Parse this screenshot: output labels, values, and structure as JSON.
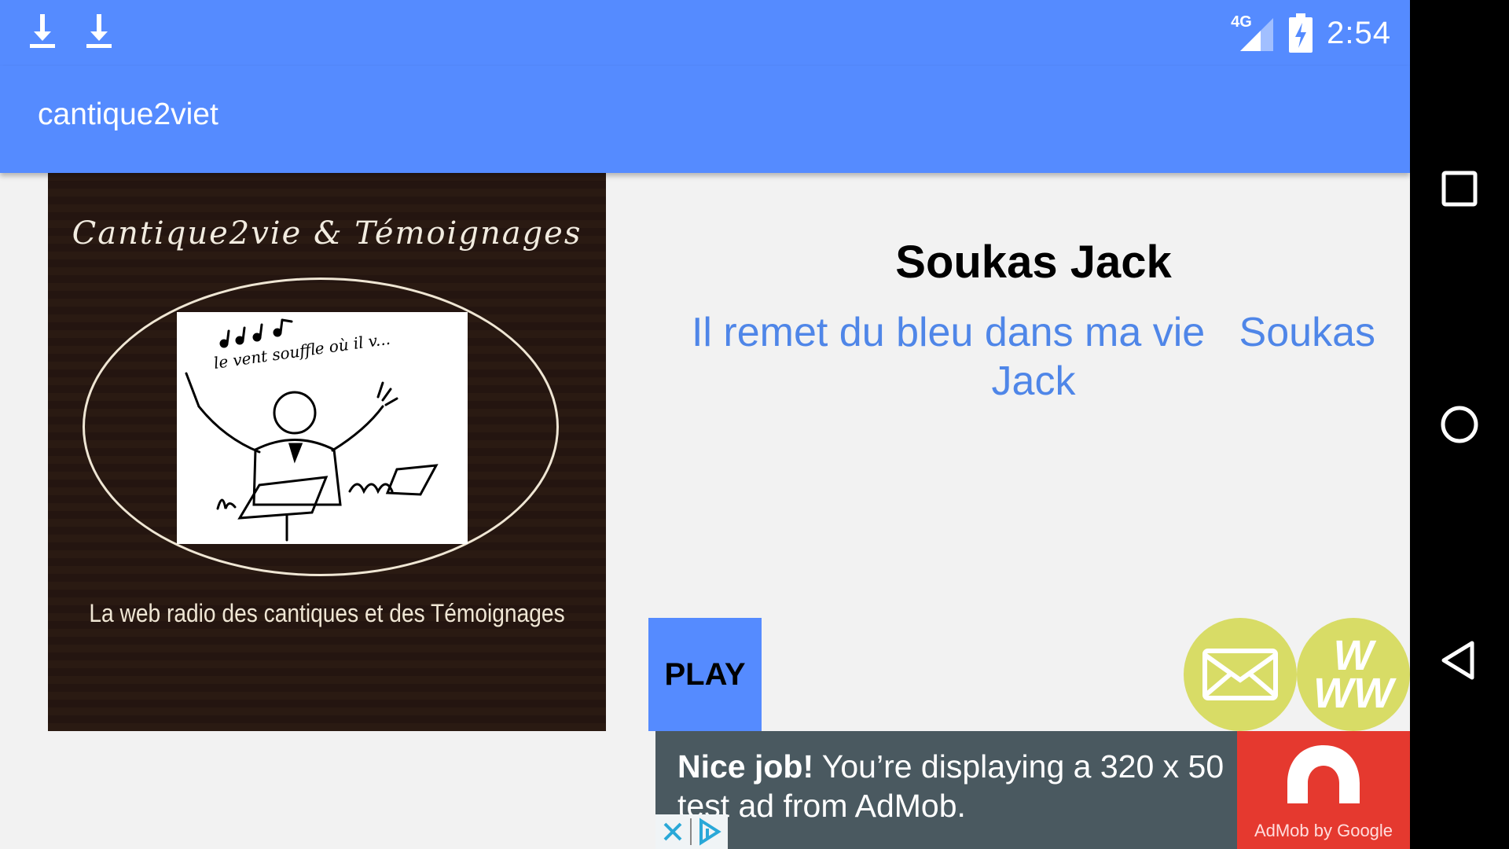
{
  "status_bar": {
    "network": "4G",
    "time": "2:54",
    "icons": [
      "download-icon",
      "download-icon",
      "signal-icon",
      "battery-charging-icon"
    ]
  },
  "app_bar": {
    "title": "cantique2viet"
  },
  "album_art": {
    "heading": "Cantique2vie & Témoignages",
    "caption": "La web radio des cantiques et des Témoignages",
    "colors": {
      "background": "#2a1a12",
      "line": "#efe6d4"
    }
  },
  "now_playing": {
    "artist": "Soukas Jack",
    "title": "Il remet du bleu dans ma vie   Soukas Jack"
  },
  "controls": {
    "play_label": "PLAY",
    "email_icon": "envelope-icon",
    "website_label": "W\nWW"
  },
  "ad": {
    "bold": "Nice job!",
    "text": " You’re displaying a 320 x 50 test ad from AdMob.",
    "logo_caption": "AdMob by Google"
  },
  "nav_bar": {
    "icons": [
      "recents-icon",
      "home-icon",
      "back-icon"
    ]
  },
  "colors": {
    "primary": "#558bff",
    "link": "#4f86e8",
    "accent_circle": "#d8dc66",
    "ad_bg": "#4a5960",
    "ad_logo_bg": "#e5392f"
  }
}
